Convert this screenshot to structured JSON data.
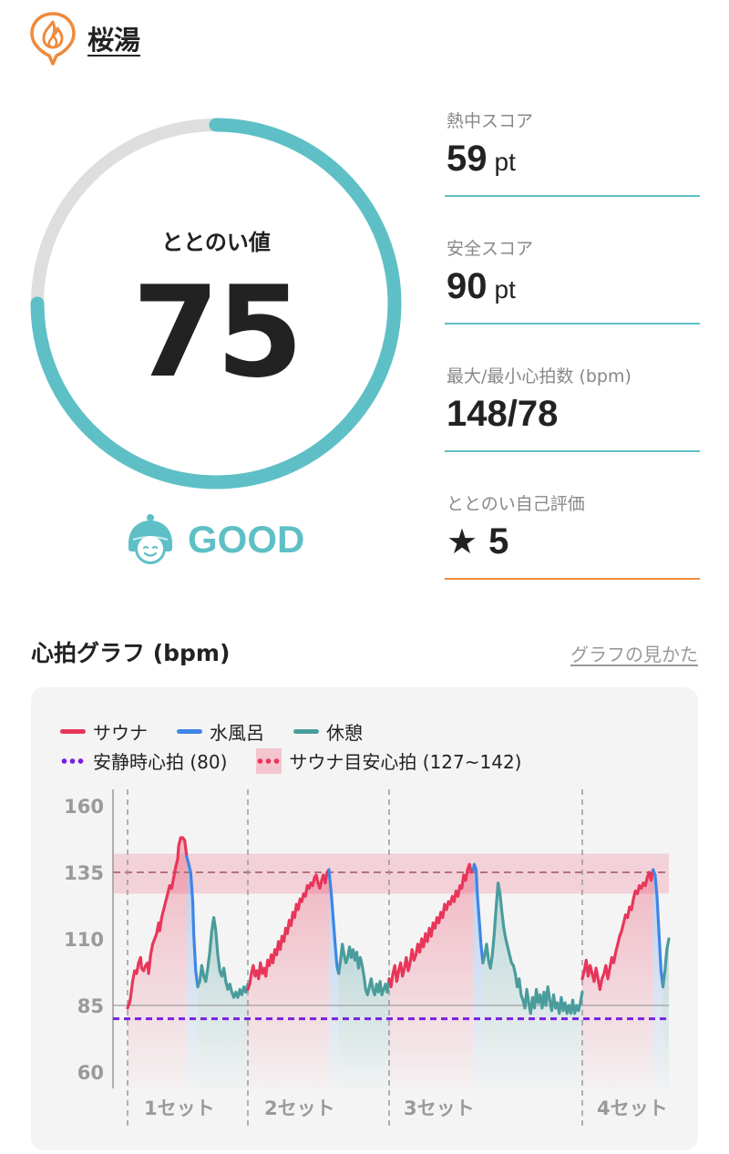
{
  "header": {
    "facility_name": "桜湯",
    "logo_icon": "flame-pin-icon"
  },
  "gauge": {
    "label": "ととのい値",
    "value": "75",
    "fraction": 0.75,
    "color": "#5ec0c6",
    "track_color": "#dedede"
  },
  "status": {
    "icon": "hood-face-icon",
    "text": "GOOD"
  },
  "stats": [
    {
      "label": "熱中スコア",
      "value": "59",
      "unit": "pt"
    },
    {
      "label": "安全スコア",
      "value": "90",
      "unit": "pt"
    },
    {
      "label": "最大/最小心拍数 (bpm)",
      "value": "148/78",
      "unit": ""
    },
    {
      "label": "ととのい自己評価",
      "value": "5",
      "icon": "star-icon"
    }
  ],
  "graph_section": {
    "title": "心拍グラフ (bpm)",
    "link": "グラフの見かた"
  },
  "chart_data": {
    "type": "line",
    "legend": {
      "sauna": "サウナ",
      "water": "水風呂",
      "rest": "休憩",
      "resting_hr": "安静時心拍 (80)",
      "target_band": "サウナ目安心拍 (127~142)"
    },
    "colors": {
      "sauna": "#e8365a",
      "water": "#3f86e6",
      "rest": "#4a9c9c",
      "resting_hr": "#7a1fe0",
      "band": "#f3c6cf"
    },
    "y_ticks": [
      "160",
      "135",
      "110",
      "85",
      "60"
    ],
    "ylim": [
      60,
      160
    ],
    "resting_hr": 80,
    "target_band": [
      127,
      142
    ],
    "sets": [
      {
        "label": "1セット",
        "sauna": [
          [
            0,
            84
          ],
          [
            2,
            86
          ],
          [
            3,
            88
          ],
          [
            5,
            94
          ],
          [
            7,
            98
          ],
          [
            9,
            97
          ],
          [
            11,
            101
          ],
          [
            13,
            103
          ],
          [
            14,
            99
          ],
          [
            16,
            98
          ],
          [
            18,
            100
          ],
          [
            20,
            101
          ],
          [
            21,
            97
          ],
          [
            23,
            104
          ],
          [
            25,
            108
          ],
          [
            27,
            110
          ],
          [
            29,
            112
          ],
          [
            31,
            116
          ],
          [
            32,
            113
          ],
          [
            34,
            118
          ],
          [
            36,
            121
          ],
          [
            38,
            124
          ],
          [
            40,
            127
          ],
          [
            42,
            130
          ],
          [
            44,
            129
          ],
          [
            46,
            133
          ],
          [
            48,
            137
          ],
          [
            50,
            140
          ],
          [
            51,
            145
          ],
          [
            53,
            148
          ],
          [
            55,
            148
          ],
          [
            57,
            147
          ],
          [
            59,
            141
          ]
        ],
        "water": [
          [
            59,
            141
          ],
          [
            61,
            138
          ],
          [
            63,
            135
          ],
          [
            65,
            124
          ],
          [
            66,
            112
          ],
          [
            68,
            98
          ],
          [
            70,
            92
          ]
        ],
        "rest": [
          [
            70,
            92
          ],
          [
            72,
            94
          ],
          [
            74,
            100
          ],
          [
            76,
            96
          ],
          [
            78,
            94
          ],
          [
            80,
            99
          ],
          [
            82,
            105
          ],
          [
            84,
            113
          ],
          [
            86,
            118
          ],
          [
            88,
            113
          ],
          [
            90,
            104
          ],
          [
            92,
            98
          ],
          [
            94,
            96
          ],
          [
            96,
            99
          ],
          [
            98,
            94
          ],
          [
            100,
            91
          ],
          [
            102,
            93
          ],
          [
            104,
            90
          ],
          [
            106,
            88
          ],
          [
            108,
            90
          ],
          [
            110,
            88
          ],
          [
            112,
            91
          ],
          [
            114,
            89
          ],
          [
            116,
            92
          ],
          [
            118,
            90
          ],
          [
            120,
            93
          ]
        ]
      },
      {
        "label": "2セット",
        "sauna": [
          [
            0,
            91
          ],
          [
            2,
            93
          ],
          [
            4,
            97
          ],
          [
            6,
            100
          ],
          [
            8,
            96
          ],
          [
            10,
            98
          ],
          [
            12,
            95
          ],
          [
            14,
            101
          ],
          [
            16,
            97
          ],
          [
            18,
            99
          ],
          [
            20,
            96
          ],
          [
            22,
            102
          ],
          [
            24,
            100
          ],
          [
            26,
            104
          ],
          [
            28,
            101
          ],
          [
            30,
            106
          ],
          [
            32,
            104
          ],
          [
            34,
            109
          ],
          [
            36,
            106
          ],
          [
            38,
            111
          ],
          [
            40,
            109
          ],
          [
            42,
            114
          ],
          [
            44,
            112
          ],
          [
            46,
            117
          ],
          [
            48,
            115
          ],
          [
            50,
            120
          ],
          [
            52,
            118
          ],
          [
            54,
            123
          ],
          [
            56,
            121
          ],
          [
            58,
            125
          ],
          [
            60,
            124
          ],
          [
            62,
            127
          ],
          [
            64,
            126
          ],
          [
            66,
            130
          ],
          [
            68,
            129
          ],
          [
            70,
            131
          ],
          [
            72,
            130
          ],
          [
            74,
            133
          ],
          [
            76,
            134
          ],
          [
            78,
            131
          ],
          [
            80,
            129
          ],
          [
            82,
            132
          ],
          [
            84,
            134
          ],
          [
            86,
            131
          ],
          [
            88,
            135
          ],
          [
            90,
            136
          ]
        ],
        "water": [
          [
            90,
            136
          ],
          [
            91,
            133
          ],
          [
            93,
            126
          ],
          [
            95,
            117
          ],
          [
            97,
            108
          ],
          [
            99,
            100
          ],
          [
            101,
            97
          ]
        ],
        "rest": [
          [
            101,
            97
          ],
          [
            103,
            102
          ],
          [
            105,
            108
          ],
          [
            107,
            104
          ],
          [
            109,
            101
          ],
          [
            111,
            103
          ],
          [
            113,
            107
          ],
          [
            115,
            103
          ],
          [
            117,
            106
          ],
          [
            119,
            102
          ],
          [
            121,
            105
          ],
          [
            123,
            99
          ],
          [
            125,
            103
          ],
          [
            127,
            100
          ],
          [
            129,
            96
          ],
          [
            131,
            91
          ],
          [
            133,
            89
          ],
          [
            135,
            92
          ],
          [
            137,
            95
          ],
          [
            139,
            91
          ],
          [
            141,
            89
          ],
          [
            143,
            93
          ],
          [
            145,
            90
          ],
          [
            147,
            94
          ],
          [
            149,
            89
          ],
          [
            151,
            91
          ],
          [
            153,
            93
          ],
          [
            155,
            90
          ],
          [
            157,
            95
          ]
        ]
      },
      {
        "label": "3セット",
        "sauna": [
          [
            0,
            95
          ],
          [
            2,
            92
          ],
          [
            4,
            97
          ],
          [
            6,
            100
          ],
          [
            8,
            94
          ],
          [
            10,
            98
          ],
          [
            12,
            101
          ],
          [
            14,
            96
          ],
          [
            16,
            99
          ],
          [
            18,
            103
          ],
          [
            20,
            98
          ],
          [
            22,
            101
          ],
          [
            24,
            106
          ],
          [
            26,
            102
          ],
          [
            28,
            104
          ],
          [
            30,
            108
          ],
          [
            32,
            105
          ],
          [
            34,
            110
          ],
          [
            36,
            107
          ],
          [
            38,
            112
          ],
          [
            40,
            109
          ],
          [
            42,
            114
          ],
          [
            44,
            111
          ],
          [
            46,
            116
          ],
          [
            48,
            114
          ],
          [
            50,
            118
          ],
          [
            52,
            116
          ],
          [
            54,
            120
          ],
          [
            56,
            118
          ],
          [
            58,
            123
          ],
          [
            60,
            121
          ],
          [
            62,
            124
          ],
          [
            64,
            123
          ],
          [
            66,
            126
          ],
          [
            68,
            124
          ],
          [
            70,
            128
          ],
          [
            72,
            126
          ],
          [
            74,
            130
          ],
          [
            76,
            129
          ],
          [
            78,
            134
          ],
          [
            80,
            132
          ],
          [
            82,
            136
          ],
          [
            84,
            138
          ],
          [
            86,
            135
          ],
          [
            88,
            136
          ]
        ],
        "water": [
          [
            88,
            136
          ],
          [
            89,
            138
          ],
          [
            91,
            136
          ],
          [
            92,
            128
          ],
          [
            94,
            118
          ],
          [
            96,
            108
          ],
          [
            98,
            101
          ]
        ],
        "rest": [
          [
            98,
            101
          ],
          [
            100,
            104
          ],
          [
            102,
            108
          ],
          [
            104,
            102
          ],
          [
            106,
            99
          ],
          [
            108,
            104
          ],
          [
            110,
            112
          ],
          [
            112,
            122
          ],
          [
            114,
            131
          ],
          [
            116,
            127
          ],
          [
            118,
            120
          ],
          [
            120,
            114
          ],
          [
            122,
            110
          ],
          [
            124,
            107
          ],
          [
            126,
            104
          ],
          [
            128,
            101
          ],
          [
            130,
            100
          ],
          [
            132,
            97
          ],
          [
            134,
            92
          ],
          [
            136,
            95
          ],
          [
            138,
            89
          ],
          [
            140,
            87
          ],
          [
            142,
            84
          ],
          [
            144,
            91
          ],
          [
            146,
            86
          ],
          [
            148,
            82
          ],
          [
            150,
            88
          ],
          [
            152,
            84
          ],
          [
            154,
            91
          ],
          [
            156,
            86
          ],
          [
            158,
            89
          ],
          [
            160,
            84
          ],
          [
            162,
            90
          ],
          [
            164,
            85
          ],
          [
            166,
            92
          ],
          [
            168,
            87
          ],
          [
            170,
            83
          ],
          [
            172,
            89
          ],
          [
            174,
            84
          ],
          [
            176,
            86
          ],
          [
            178,
            82
          ],
          [
            180,
            88
          ],
          [
            182,
            83
          ],
          [
            184,
            86
          ],
          [
            186,
            82
          ],
          [
            188,
            85
          ],
          [
            190,
            82
          ],
          [
            192,
            87
          ],
          [
            194,
            82
          ],
          [
            196,
            85
          ],
          [
            198,
            83
          ],
          [
            200,
            86
          ],
          [
            202,
            90
          ]
        ]
      },
      {
        "label": "4セット",
        "sauna": [
          [
            0,
            95
          ],
          [
            2,
            98
          ],
          [
            4,
            102
          ],
          [
            6,
            96
          ],
          [
            8,
            100
          ],
          [
            10,
            97
          ],
          [
            12,
            94
          ],
          [
            14,
            99
          ],
          [
            16,
            95
          ],
          [
            18,
            91
          ],
          [
            20,
            95
          ],
          [
            22,
            97
          ],
          [
            24,
            100
          ],
          [
            26,
            95
          ],
          [
            28,
            99
          ],
          [
            30,
            103
          ],
          [
            32,
            101
          ],
          [
            34,
            105
          ],
          [
            36,
            108
          ],
          [
            38,
            111
          ],
          [
            40,
            113
          ],
          [
            42,
            116
          ],
          [
            44,
            119
          ],
          [
            46,
            118
          ],
          [
            48,
            122
          ],
          [
            50,
            121
          ],
          [
            52,
            125
          ],
          [
            54,
            128
          ],
          [
            56,
            127
          ],
          [
            58,
            130
          ],
          [
            60,
            129
          ],
          [
            62,
            131
          ],
          [
            64,
            130
          ],
          [
            66,
            133
          ],
          [
            68,
            135
          ],
          [
            70,
            132
          ],
          [
            72,
            136
          ]
        ],
        "water": [
          [
            72,
            136
          ],
          [
            74,
            134
          ],
          [
            76,
            126
          ],
          [
            78,
            112
          ],
          [
            80,
            98
          ],
          [
            82,
            92
          ]
        ],
        "rest": [
          [
            82,
            92
          ],
          [
            84,
            98
          ],
          [
            86,
            106
          ],
          [
            88,
            110
          ]
        ]
      }
    ]
  }
}
